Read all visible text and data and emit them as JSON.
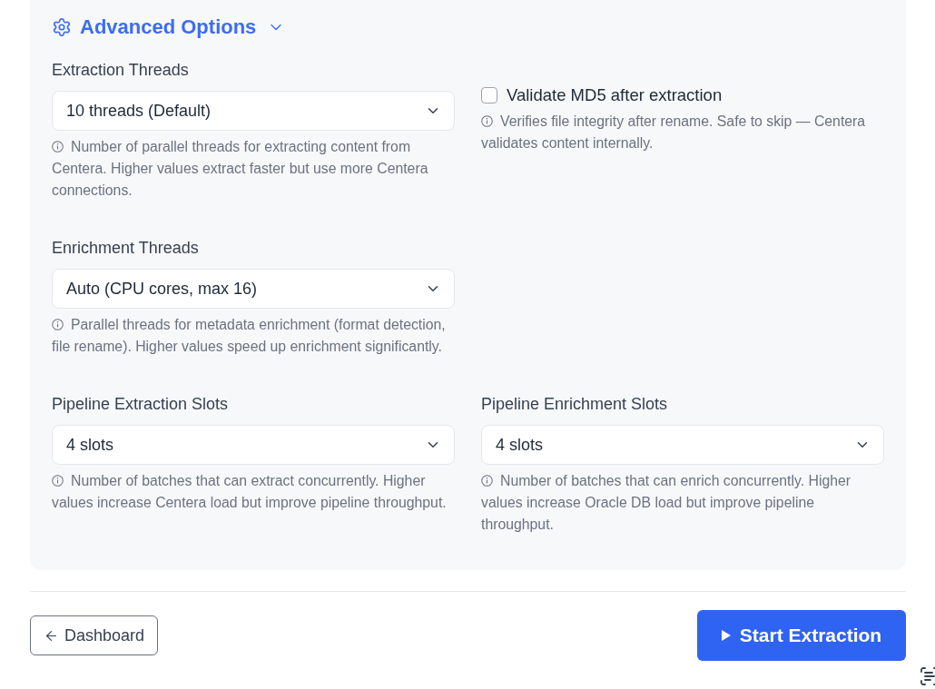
{
  "advanced_options": {
    "title": "Advanced Options",
    "expanded": true,
    "rows": [
      [
        {
          "kind": "select",
          "label": "Extraction Threads",
          "value": "10 threads (Default)",
          "help": "Number of parallel threads for extracting content from Centera. Higher values extract faster but use more Centera connections."
        },
        {
          "kind": "checkbox",
          "label": "Validate MD5 after extraction",
          "checked": false,
          "help": "Verifies file integrity after rename. Safe to skip — Centera validates content internally."
        }
      ],
      [
        {
          "kind": "select",
          "label": "Enrichment Threads",
          "value": "Auto (CPU cores, max 16)",
          "help": "Parallel threads for metadata enrichment (format detection, file rename). Higher values speed up enrichment significantly."
        }
      ],
      [
        {
          "kind": "select",
          "label": "Pipeline Extraction Slots",
          "value": "4 slots",
          "help": "Number of batches that can extract concurrently. Higher values increase Centera load but improve pipeline throughput."
        },
        {
          "kind": "select",
          "label": "Pipeline Enrichment Slots",
          "value": "4 slots",
          "help": "Number of batches that can enrich concurrently. Higher values increase Oracle DB load but improve pipeline throughput."
        }
      ]
    ]
  },
  "footer": {
    "back_button": "Dashboard",
    "start_button": "Start Extraction"
  }
}
